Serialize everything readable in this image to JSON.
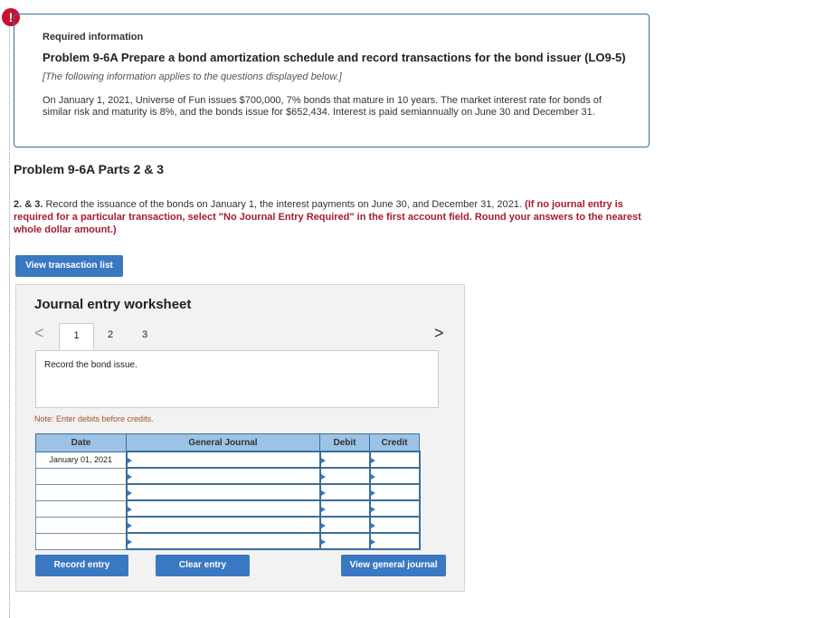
{
  "required_info": {
    "header": "Required information",
    "problem_title": "Problem 9-6A Prepare a bond amortization schedule and record transactions for the bond issuer (LO9-5)",
    "applies_note": "[The following information applies to the questions displayed below.]",
    "description": "On January 1, 2021, Universe of Fun issues $700,000, 7% bonds that mature in 10 years. The market interest rate for bonds of similar risk and maturity is 8%, and the bonds issue for $652,434. Interest is paid semiannually on June 30 and December 31."
  },
  "part_heading": "Problem 9-6A Parts 2 & 3",
  "instructions": {
    "number": "2. & 3.",
    "text": " Record the issuance of the bonds on January 1, the interest payments on June 30, and December 31, 2021. ",
    "red_text": "(If no journal entry is required for a particular transaction, select \"No Journal Entry Required\" in the first account field. Round your answers to the nearest whole dollar amount.)"
  },
  "buttons": {
    "view_transactions": "View transaction list",
    "record_entry": "Record entry",
    "clear_entry": "Clear entry",
    "view_general_journal": "View general journal"
  },
  "worksheet": {
    "title": "Journal entry worksheet",
    "tabs": [
      "1",
      "2",
      "3"
    ],
    "active_tab": "1",
    "prev_icon": "<",
    "next_icon": ">",
    "transaction_description": "Record the bond issue.",
    "note": "Note: Enter debits before credits.",
    "columns": {
      "date": "Date",
      "account": "General Journal",
      "debit": "Debit",
      "credit": "Credit"
    },
    "rows": [
      {
        "date": "January 01, 2021",
        "account": "",
        "debit": "",
        "credit": ""
      },
      {
        "date": "",
        "account": "",
        "debit": "",
        "credit": ""
      },
      {
        "date": "",
        "account": "",
        "debit": "",
        "credit": ""
      },
      {
        "date": "",
        "account": "",
        "debit": "",
        "credit": ""
      },
      {
        "date": "",
        "account": "",
        "debit": "",
        "credit": ""
      },
      {
        "date": "",
        "account": "",
        "debit": "",
        "credit": ""
      }
    ]
  },
  "alert_icon": "!"
}
